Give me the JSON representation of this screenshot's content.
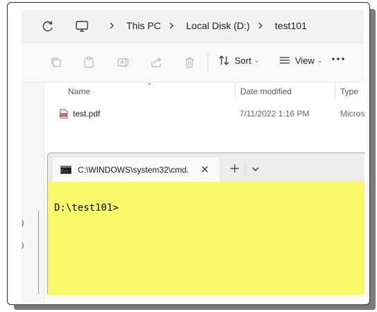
{
  "explorer": {
    "breadcrumb": [
      "This PC",
      "Local Disk (D:)",
      "test101"
    ],
    "toolbar": {
      "sort_label": "Sort",
      "view_label": "View"
    },
    "columns": [
      "Name",
      "Date modified",
      "Type"
    ],
    "files": [
      {
        "name": "test.pdf",
        "date": "7/11/2022 1:16 PM",
        "type": "Micros"
      }
    ],
    "sidebar_fragments": [
      ")",
      ")"
    ]
  },
  "cmd": {
    "tab_title": "C:\\WINDOWS\\system32\\cmd.",
    "prompt": "D:\\test101>",
    "background_color": "#f9f96a"
  }
}
